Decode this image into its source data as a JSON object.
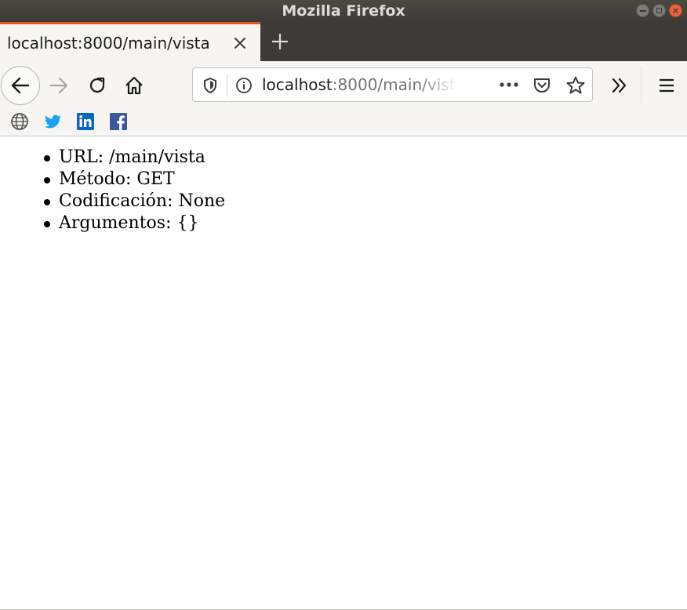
{
  "window": {
    "title": "Mozilla Firefox",
    "controls": [
      "minimize-icon",
      "maximize-icon",
      "close-icon"
    ]
  },
  "tabs": [
    {
      "label": "localhost:8000/main/vista",
      "active": true
    }
  ],
  "urlbar": {
    "host": "localhost",
    "rest": ":8000/main/vista",
    "icons": [
      "shield-icon",
      "info-icon",
      "more-icon",
      "pocket-icon",
      "star-icon"
    ]
  },
  "toolbar_icons": [
    "back-icon",
    "forward-icon",
    "reload-icon",
    "home-icon",
    "overflow-icon",
    "menu-icon"
  ],
  "bookmarks": [
    "globe-icon",
    "twitter-icon",
    "linkedin-icon",
    "facebook-icon"
  ],
  "content": {
    "items": [
      "URL: /main/vista",
      "Método: GET",
      "Codificación: None",
      "Argumentos: {}"
    ]
  },
  "colors": {
    "accent": "#e95420",
    "titlebar": "#3c3b37",
    "toolbar": "#f6f5f3",
    "twitter": "#1da1f2",
    "linkedin": "#0a66c2",
    "facebook": "#3b5998"
  }
}
